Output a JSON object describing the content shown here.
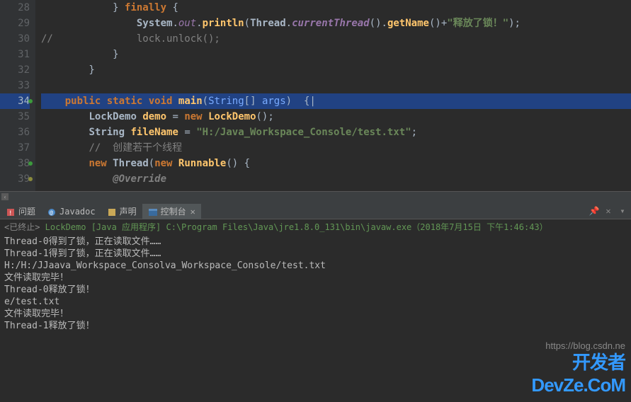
{
  "editor": {
    "lines": [
      {
        "num": 28,
        "marker": null,
        "hl": false,
        "tokens": [
          {
            "t": "            } "
          },
          {
            "t": "finally",
            "c": "kw"
          },
          {
            "t": " {"
          }
        ]
      },
      {
        "num": 29,
        "marker": null,
        "hl": false,
        "tokens": [
          {
            "t": "                "
          },
          {
            "t": "System",
            "c": "cls"
          },
          {
            "t": "."
          },
          {
            "t": "out",
            "c": "sfield"
          },
          {
            "t": "."
          },
          {
            "t": "println",
            "c": "mth"
          },
          {
            "t": "("
          },
          {
            "t": "Thread",
            "c": "cls"
          },
          {
            "t": "."
          },
          {
            "t": "currentThread",
            "c": "imeth"
          },
          {
            "t": "()."
          },
          {
            "t": "getName",
            "c": "mth"
          },
          {
            "t": "()+"
          },
          {
            "t": "\"释放了锁！\"",
            "c": "str"
          },
          {
            "t": ");"
          }
        ]
      },
      {
        "num": 30,
        "marker": null,
        "hl": false,
        "tokens": [
          {
            "t": "//              lock.unlock();",
            "c": "cmt"
          }
        ]
      },
      {
        "num": 31,
        "marker": null,
        "hl": false,
        "tokens": [
          {
            "t": "            }"
          }
        ]
      },
      {
        "num": 32,
        "marker": null,
        "hl": false,
        "tokens": [
          {
            "t": "        }"
          }
        ]
      },
      {
        "num": 33,
        "marker": null,
        "hl": false,
        "tokens": [
          {
            "t": " "
          }
        ]
      },
      {
        "num": 34,
        "marker": "#3c9a3c",
        "hl": true,
        "tokens": [
          {
            "t": "    "
          },
          {
            "t": "public",
            "c": "kw"
          },
          {
            "t": " "
          },
          {
            "t": "static",
            "c": "kw"
          },
          {
            "t": " "
          },
          {
            "t": "void",
            "c": "kw"
          },
          {
            "t": " "
          },
          {
            "t": "main",
            "c": "decl"
          },
          {
            "t": "("
          },
          {
            "t": "String",
            "c": "param"
          },
          {
            "t": "[] "
          },
          {
            "t": "args",
            "c": "param"
          },
          {
            "t": ")  {"
          },
          {
            "t": "|"
          }
        ]
      },
      {
        "num": 35,
        "marker": null,
        "hl": false,
        "tokens": [
          {
            "t": "        "
          },
          {
            "t": "LockDemo",
            "c": "cls"
          },
          {
            "t": " "
          },
          {
            "t": "demo",
            "c": "decl"
          },
          {
            "t": " = "
          },
          {
            "t": "new",
            "c": "kw"
          },
          {
            "t": " "
          },
          {
            "t": "LockDemo",
            "c": "mth"
          },
          {
            "t": "();"
          }
        ]
      },
      {
        "num": 36,
        "marker": null,
        "hl": false,
        "tokens": [
          {
            "t": "        "
          },
          {
            "t": "String",
            "c": "cls"
          },
          {
            "t": " "
          },
          {
            "t": "fileName",
            "c": "decl"
          },
          {
            "t": " = "
          },
          {
            "t": "\"H:/Java_Workspace_Console/test.txt\"",
            "c": "str"
          },
          {
            "t": ";"
          }
        ]
      },
      {
        "num": 37,
        "marker": null,
        "hl": false,
        "tokens": [
          {
            "t": "        "
          },
          {
            "t": "//  创建若干个线程",
            "c": "cmt"
          }
        ]
      },
      {
        "num": 38,
        "marker": "#3c9a3c",
        "hl": false,
        "tokens": [
          {
            "t": "        "
          },
          {
            "t": "new",
            "c": "kw"
          },
          {
            "t": " "
          },
          {
            "t": "Thread",
            "c": "cls"
          },
          {
            "t": "("
          },
          {
            "t": "new",
            "c": "kw"
          },
          {
            "t": " "
          },
          {
            "t": "Runnable",
            "c": "mth"
          },
          {
            "t": "() {"
          }
        ]
      },
      {
        "num": 39,
        "marker": "#8a8a3c",
        "hl": false,
        "tokens": [
          {
            "t": "            "
          },
          {
            "t": "@Override",
            "c": "ann"
          }
        ]
      }
    ]
  },
  "tabs": {
    "problems": "问题",
    "javadoc": "Javadoc",
    "declaration": "声明",
    "console": "控制台"
  },
  "toolbar": {
    "pin": "📌",
    "close": "✕",
    "menu": "▾"
  },
  "console": {
    "header_status": "<已终止>",
    "header_rest": " LockDemo [Java 应用程序] C:\\Program Files\\Java\\jre1.8.0_131\\bin\\javaw.exe（2018年7月15日 下午1:46:43）",
    "lines": [
      "Thread-0得到了锁，正在读取文件……",
      "Thread-1得到了锁，正在读取文件……",
      "H:/H:/JJaava_Workspace_Consolva_Workspace_Console/test.txt",
      "文件读取完毕！",
      "Thread-0释放了锁！",
      "e/test.txt",
      "文件读取完毕！",
      "Thread-1释放了锁！"
    ]
  },
  "watermark": {
    "url": "https://blog.csdn.ne",
    "logo1": "开发者",
    "logo2": "DevZe.CoM"
  }
}
